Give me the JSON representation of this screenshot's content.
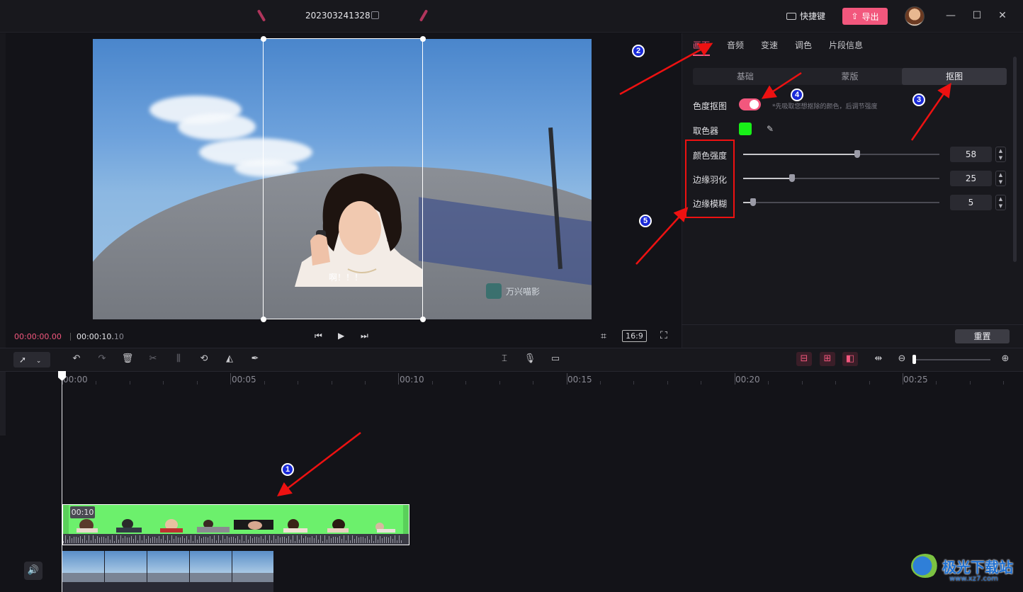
{
  "titlebar": {
    "project_name": "202303241328",
    "shortcut_label": "快捷键",
    "export_label": "导出",
    "minimize_icon": "—",
    "maximize_icon": "☐",
    "close_icon": "✕"
  },
  "preview": {
    "subtitle": "啊！！！",
    "watermark": "万兴喵影",
    "time_current": "00:00:00.00",
    "time_total_main": "00:00:10.",
    "time_total_frames": "10",
    "aspect_ratio": "16:9"
  },
  "panel": {
    "tabs": [
      "画面",
      "音频",
      "变速",
      "调色",
      "片段信息"
    ],
    "active_tab": "画面",
    "subtabs": [
      "基础",
      "蒙版",
      "抠图"
    ],
    "active_subtab": "抠图",
    "chroma_key_label": "色度抠图",
    "chroma_key_enabled": true,
    "hint": "*先吸取您想抠除的颜色，后调节强度",
    "picker_label": "取色器",
    "picker_color": "#18f018",
    "sliders": [
      {
        "label": "颜色强度",
        "value": "58",
        "fraction": 0.58
      },
      {
        "label": "边缘羽化",
        "value": "25",
        "fraction": 0.25
      },
      {
        "label": "边缘模糊",
        "value": "5",
        "fraction": 0.05
      }
    ],
    "reset_label": "重置"
  },
  "timeline": {
    "ticks": [
      "00:00",
      "00:05",
      "00:10",
      "00:15",
      "00:20",
      "00:25"
    ],
    "clip_duration": "00:10"
  },
  "annotations": {
    "n1": "1",
    "n2": "2",
    "n3": "3",
    "n4": "4",
    "n5": "5"
  },
  "watermark_site": {
    "name": "极光下载站",
    "url": "www.xz7.com"
  },
  "colors": {
    "accent": "#f2577d",
    "annotation_arrow": "#ee1111",
    "annotation_badge": "#1a2ad8",
    "green_screen": "#6cf06c"
  }
}
